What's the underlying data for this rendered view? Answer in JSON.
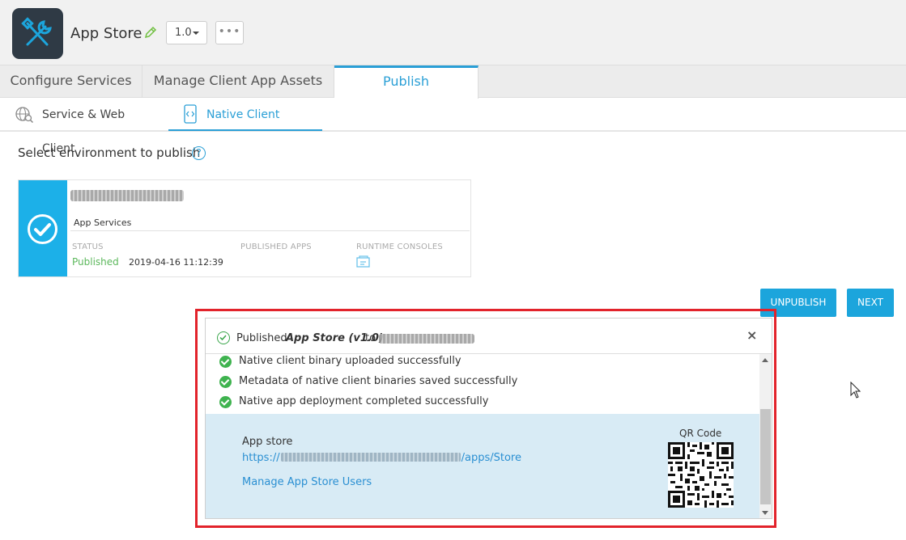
{
  "header": {
    "app_title": "App Store",
    "version": "1.0",
    "more_label": "•••"
  },
  "tabs": [
    {
      "label": "Configure Services"
    },
    {
      "label": "Manage Client App Assets"
    },
    {
      "label": "Publish",
      "active": true
    }
  ],
  "subtabs": [
    {
      "label": "Service & Web Client"
    },
    {
      "label": "Native Client",
      "active": true
    }
  ],
  "environment": {
    "heading": "Select environment to publish",
    "help": "?",
    "card": {
      "type": "App Services",
      "status_header": "STATUS",
      "published_apps_header": "PUBLISHED APPS",
      "runtime_consoles_header": "RUNTIME CONSOLES",
      "status": "Published",
      "date": "2019-04-16 11:12:39"
    }
  },
  "buttons": {
    "unpublish": "UNPUBLISH",
    "next": "NEXT"
  },
  "dialog": {
    "title_prefix": "Published",
    "app_name": "App Store (v1.0)",
    "title_to": "to",
    "close": "×",
    "messages": [
      "Native client binary uploaded successfully",
      "Metadata of native client binaries saved successfully",
      "Native app deployment completed successfully"
    ],
    "store_label": "App store",
    "store_link_prefix": "https://",
    "store_link_suffix": "/apps/Store",
    "manage_link": "Manage App Store Users",
    "qr_label": "QR Code"
  },
  "colors": {
    "accent": "#1ca5dc",
    "success": "#3fb34f",
    "highlight": "#e2232b",
    "info_bg": "#d8ebf5"
  }
}
